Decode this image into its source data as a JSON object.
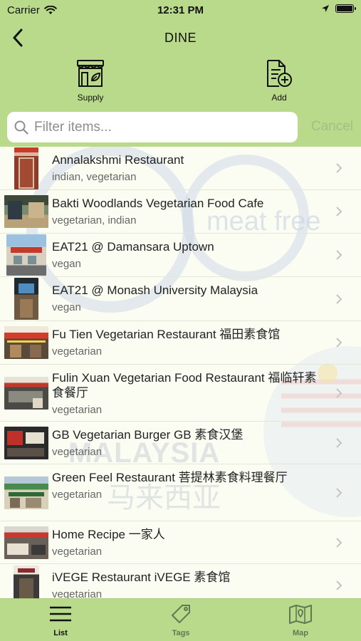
{
  "status_bar": {
    "carrier": "Carrier",
    "time": "12:31 PM"
  },
  "nav": {
    "title": "DINE"
  },
  "toolbar": {
    "supply_label": "Supply",
    "add_label": "Add"
  },
  "search": {
    "placeholder": "Filter items...",
    "value": "",
    "cancel_label": "Cancel"
  },
  "list": {
    "items": [
      {
        "name": "Annalakshmi Restaurant",
        "tags": "indian, vegetarian"
      },
      {
        "name": "Bakti Woodlands Vegetarian Food Cafe",
        "tags": "vegetarian, indian"
      },
      {
        "name": "EAT21 @ Damansara Uptown",
        "tags": "vegan"
      },
      {
        "name": "EAT21 @ Monash University Malaysia",
        "tags": "vegan"
      },
      {
        "name": "Fu Tien Vegetarian Restaurant  福田素食馆",
        "tags": "vegetarian"
      },
      {
        "name": "Fulin Xuan Vegetarian Food Restaurant  福临轩素食餐厅",
        "tags": "vegetarian"
      },
      {
        "name": "GB Vegetarian Burger  GB 素食汉堡",
        "tags": "vegetarian"
      },
      {
        "name": "Green Feel Restaurant  菩提林素食料理餐厅",
        "tags": "vegetarian"
      },
      {
        "name": "Home Recipe  一家人",
        "tags": "vegetarian"
      },
      {
        "name": "iVEGE Restaurant  iVEGE 素食馆",
        "tags": "vegetarian"
      }
    ]
  },
  "watermark": {
    "brand": "meat free",
    "country": "MALAYSIA",
    "country_cn": "马来西亚"
  },
  "tabbar": {
    "list_label": "List",
    "tags_label": "Tags",
    "map_label": "Map"
  },
  "colors": {
    "bar_green": "#b9da8b",
    "accent_green": "#a3bf84",
    "list_bg": "#fbfdf3"
  }
}
